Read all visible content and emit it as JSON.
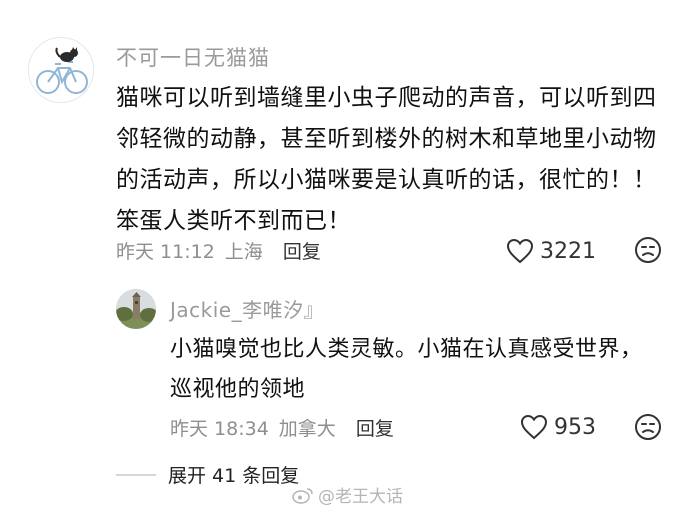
{
  "main_comment": {
    "username": "不可一日无猫猫",
    "text": "猫咪可以听到墙缝里小虫子爬动的声音，可以听到四邻轻微的动静，甚至听到楼外的树木和草地里小动物的活动声，所以小猫咪要是认真听的话，很忙的！！ 笨蛋人类听不到而已！",
    "time": "昨天 11:12",
    "location": "上海",
    "reply_label": "回复",
    "likes": "3221",
    "avatar_icon": "cat-on-bicycle-avatar",
    "like_icon": "heart-outline-icon",
    "dislike_icon": "frown-face-icon"
  },
  "reply_comment": {
    "username": "Jackie_李唯汐』",
    "text": "小猫嗅觉也比人类灵敏。小猫在认真感受世界，巡视他的领地",
    "time": "昨天 18:34",
    "location": "加拿大",
    "reply_label": "回复",
    "likes": "953",
    "avatar_icon": "tower-photo-avatar"
  },
  "expand": {
    "label": "展开 41 条回复"
  },
  "watermark": {
    "text": "@老王大话"
  },
  "colors": {
    "secondary_text": "#9a9a9a",
    "primary_text": "#111111",
    "divider": "#d6d6d6"
  }
}
